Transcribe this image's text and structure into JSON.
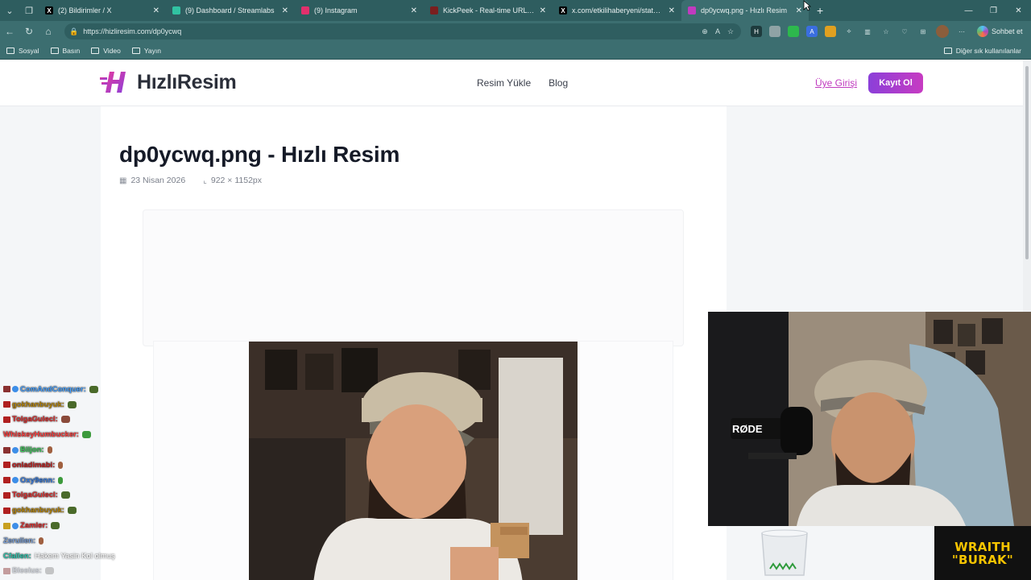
{
  "browser": {
    "tabs": [
      {
        "label": "(2) Bildirimler / X",
        "icon": "x-logo-icon",
        "color": "#000000",
        "active": false
      },
      {
        "label": "(9) Dashboard / Streamlabs",
        "icon": "streamlabs-icon",
        "color": "#31c3a2",
        "active": false
      },
      {
        "label": "(9) Instagram",
        "icon": "instagram-icon",
        "color": "#e1306c",
        "active": false
      },
      {
        "label": "KickPeek - Real-time URL Crawler",
        "icon": "kickpeek-icon",
        "color": "#7a1f1f",
        "active": false
      },
      {
        "label": "x.com/etkilihaberyeni/status/2047",
        "icon": "x-logo-icon",
        "color": "#000000",
        "active": false
      },
      {
        "label": "dp0ycwq.png - Hızlı Resim",
        "icon": "hizliresim-icon",
        "color": "#c03bbf",
        "active": true
      }
    ],
    "url": "https://hizliresim.com/dp0ycwq",
    "chat_button": "Sohbet et",
    "bookmarks": [
      "Sosyal",
      "Basın",
      "Video",
      "Yayın"
    ],
    "other_bookmarks": "Diğer sık kullanılanlar"
  },
  "site": {
    "logo_text": "HızlıResim",
    "nav": [
      "Resim Yükle",
      "Blog"
    ],
    "login": "Üye Girişi",
    "signup": "Kayıt Ol",
    "brand_color": "#c03bbf"
  },
  "image": {
    "title": "dp0ycwq.png - Hızlı Resim",
    "date": "23 Nisan 2026",
    "dimensions": "922 × 1152px"
  },
  "chat": [
    {
      "user": "ComAndConquer:",
      "color": "#4aa3ff",
      "msg": ""
    },
    {
      "user": "gokhanbuyuk:",
      "color": "#b8860b",
      "msg": ""
    },
    {
      "user": "TolgaGulecl:",
      "color": "#e03030",
      "msg": ""
    },
    {
      "user": "WhiskeyHumbucker:",
      "color": "#ff4040",
      "msg": ""
    },
    {
      "user": "Biljon:",
      "color": "#3cc85a",
      "msg": ""
    },
    {
      "user": "onladimabi:",
      "color": "#c02020",
      "msg": ""
    },
    {
      "user": "Oxy9enn:",
      "color": "#3a7ee0",
      "msg": ""
    },
    {
      "user": "TolgaGulecl:",
      "color": "#e03030",
      "msg": ""
    },
    {
      "user": "gokhanbuyuk:",
      "color": "#b8860b",
      "msg": ""
    },
    {
      "user": "Zamler:",
      "color": "#e03030",
      "msg": ""
    },
    {
      "user": "Zerulien:",
      "color": "#7aa0d8",
      "msg": ""
    },
    {
      "user": "Cfallen:",
      "color": "#2fc8b0",
      "msg": "Hakem Yasin Kol olmuş"
    },
    {
      "user": "Bleeius:",
      "color": "#9aa0b0",
      "msg": ""
    }
  ],
  "overlay": {
    "mic_brand": "RØDE",
    "badge_line1": "WRAITH",
    "badge_line2": "\"BURAK\""
  }
}
